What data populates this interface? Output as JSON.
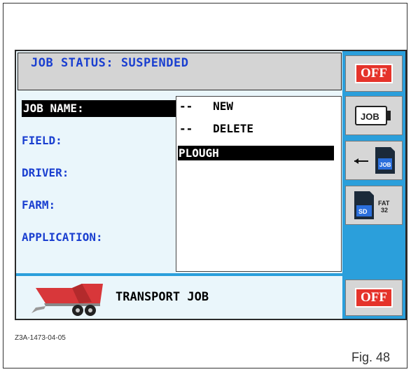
{
  "status_bar": {
    "text": "JOB STATUS: SUSPENDED"
  },
  "fields": [
    {
      "label": "JOB NAME:",
      "selected": true
    },
    {
      "label": "FIELD:",
      "selected": false
    },
    {
      "label": "DRIVER:",
      "selected": false
    },
    {
      "label": "FARM:",
      "selected": false
    },
    {
      "label": "APPLICATION:",
      "selected": false
    }
  ],
  "job_list": [
    {
      "label": "--   NEW",
      "selected": false
    },
    {
      "label": "--   DELETE",
      "selected": false
    },
    {
      "label": "PLOUGH",
      "selected": true
    }
  ],
  "sidebar": {
    "off_top": "OFF",
    "job_button_label": "JOB",
    "sd_job_label": "JOB",
    "sd_label": "SD",
    "fat_label_1": "FAT",
    "fat_label_2": "32",
    "off_bottom": "OFF"
  },
  "bottom": {
    "label": "TRANSPORT JOB"
  },
  "caption": {
    "id": "Z3A-1473-04-05",
    "figure": "Fig. 48"
  },
  "colors": {
    "screen_bg": "#eaf6fb",
    "accent_blue": "#2b9fdb",
    "label_blue": "#1a3fd0",
    "off_red": "#e5332a",
    "trailer_red": "#d8373a"
  }
}
